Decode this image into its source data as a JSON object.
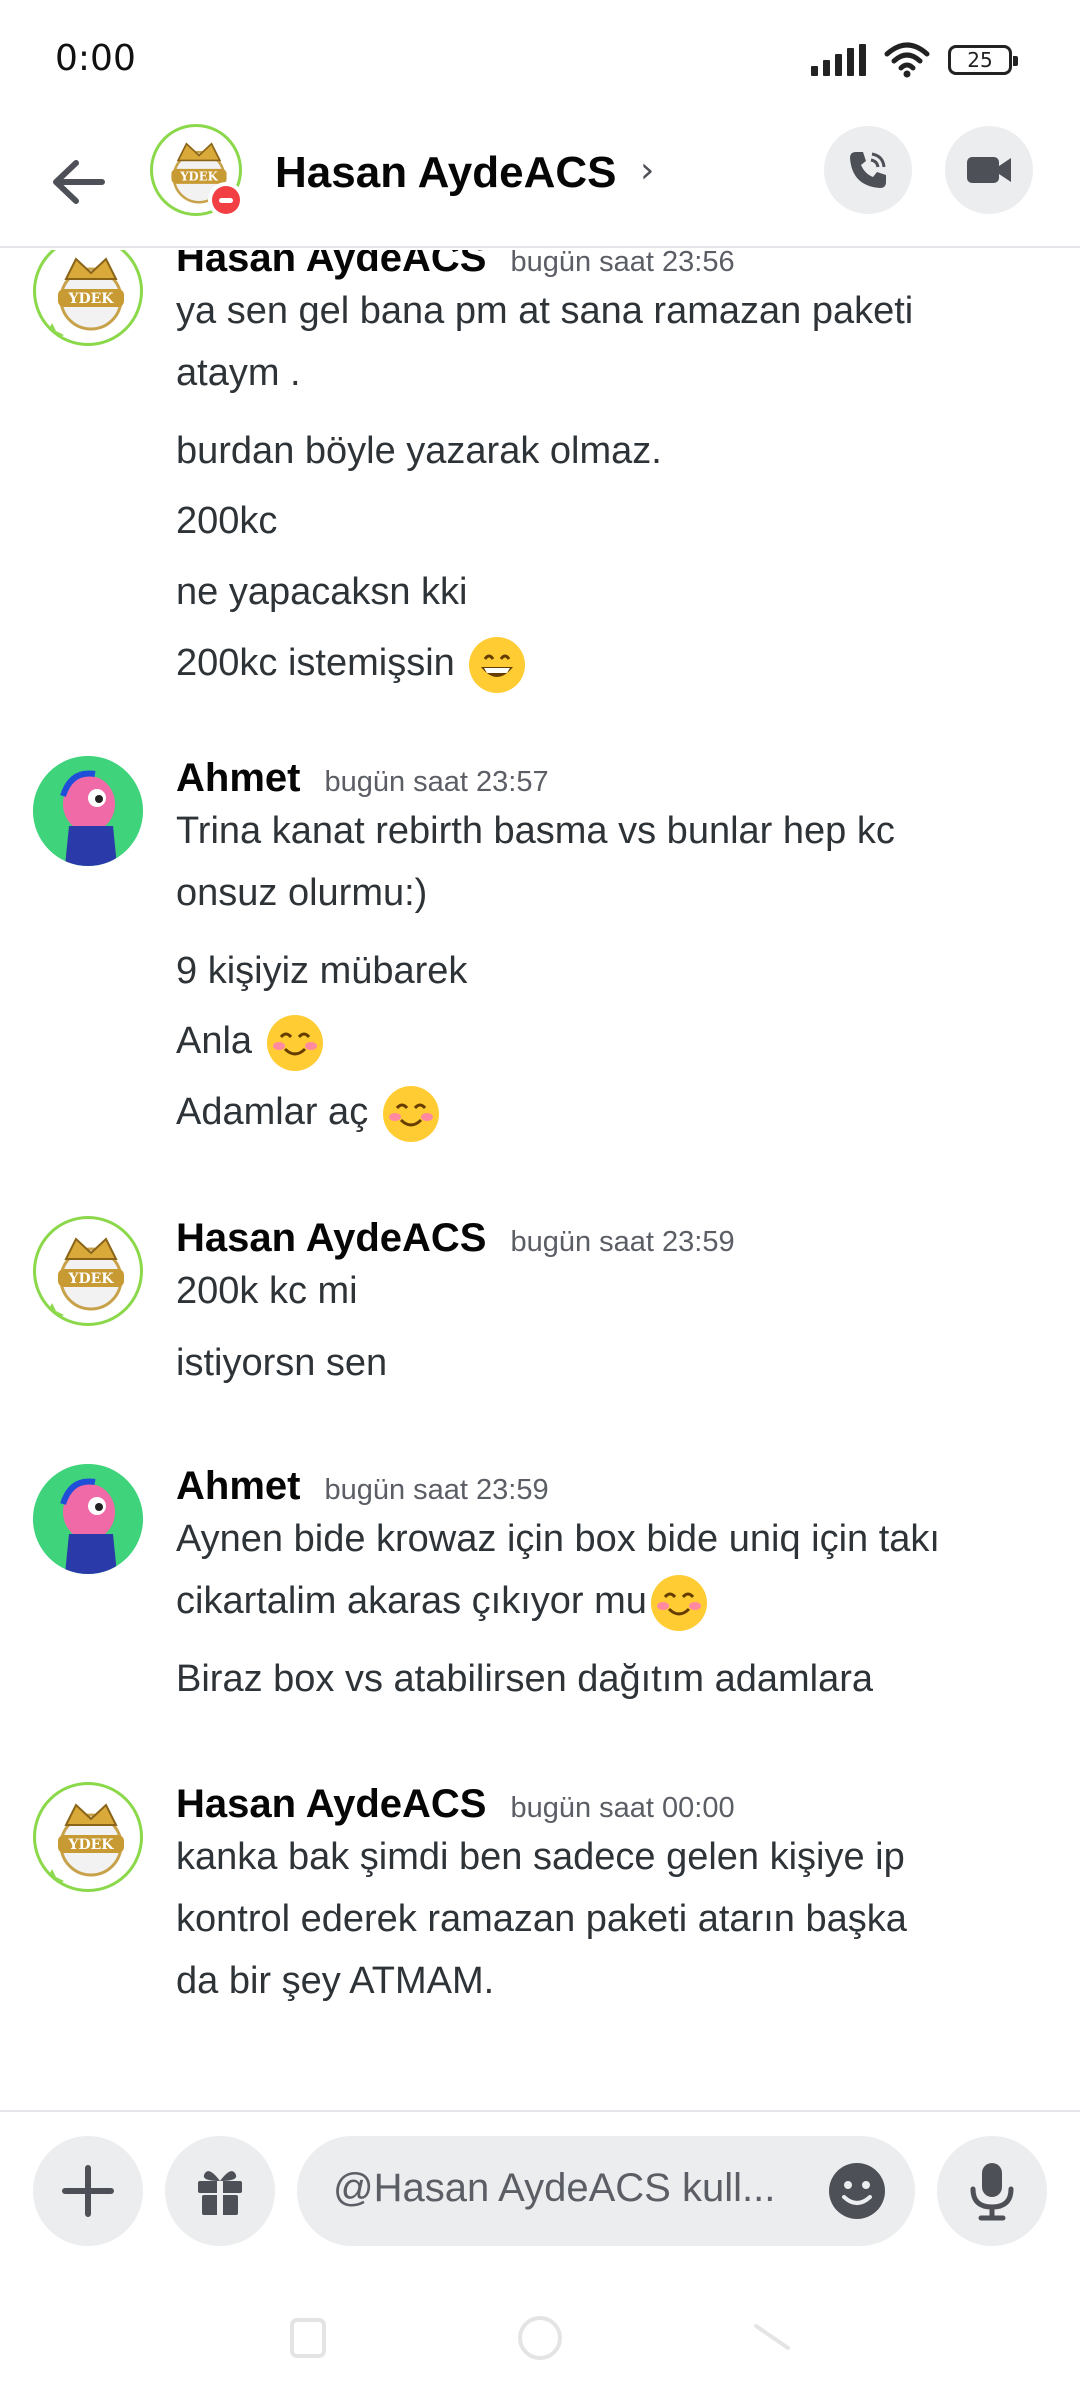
{
  "status_bar": {
    "time": "0:00",
    "battery": "25"
  },
  "header": {
    "title": "Hasan AydeACS",
    "chevron": "›"
  },
  "messages": [
    {
      "author": "Hasan AydeACS",
      "timestamp": "bugün saat 23:56",
      "avatar": "gold-crown-avatar",
      "lines": [
        {
          "text": "ya sen gel bana pm at sana ramazan paketi",
          "cont": "ataym ."
        },
        {
          "text": "burdan böyle yazarak olmaz."
        },
        {
          "text": "200kc"
        },
        {
          "text": "ne yapacaksn kki"
        },
        {
          "text": "200kc istemişsin",
          "emoji": "grinning-face"
        }
      ]
    },
    {
      "author": "Ahmet",
      "timestamp": "bugün saat 23:57",
      "avatar": "pink-character-avatar",
      "lines": [
        {
          "text": "Trina kanat rebirth basma vs bunlar hep kc",
          "cont": "onsuz olurmu:)"
        },
        {
          "text": "9 kişiyiz mübarek"
        },
        {
          "text": "Anla",
          "emoji": "smiling-face"
        },
        {
          "text": "Adamlar aç",
          "emoji": "smiling-face"
        }
      ]
    },
    {
      "author": "Hasan AydeACS",
      "timestamp": "bugün saat 23:59",
      "avatar": "gold-crown-avatar",
      "lines": [
        {
          "text": "200k kc mi"
        },
        {
          "text": "istiyorsn sen"
        }
      ]
    },
    {
      "author": "Ahmet",
      "timestamp": "bugün saat 23:59",
      "avatar": "pink-character-avatar",
      "lines": [
        {
          "text": "Aynen bide krowaz için box bide uniq için takı",
          "cont": "cikartalim akaras çıkıyor mu",
          "emoji": "smiling-face"
        },
        {
          "text": "Biraz box vs atabilirsen dağıtım adamlara"
        }
      ]
    },
    {
      "author": "Hasan AydeACS",
      "timestamp": "bugün saat 00:00",
      "avatar": "gold-crown-avatar",
      "lines": [
        {
          "text": "kanka bak şimdi ben sadece gelen kişiye ip",
          "cont": "kontrol ederek ramazan paketi atarın başka",
          "cont2": "da bir şey ATMAM."
        }
      ]
    }
  ],
  "composer": {
    "placeholder": "@Hasan AydeACS kull..."
  },
  "colors": {
    "accent": "#5865f2",
    "online_ring": "#8bd84a",
    "dnd": "#f23f43",
    "surface": "#ebedef"
  }
}
